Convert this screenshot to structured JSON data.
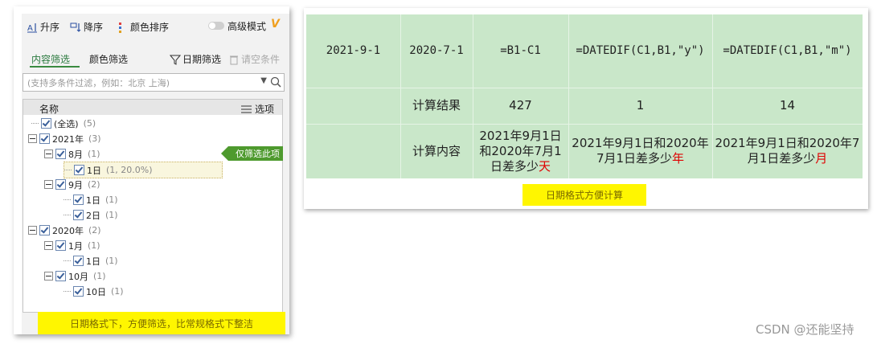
{
  "left_panel": {
    "toolbar": {
      "sort_asc": "升序",
      "sort_desc": "降序",
      "color_sort": "颜色排序",
      "advanced_mode": "高级模式"
    },
    "tabs": {
      "content": "内容筛选",
      "color": "颜色筛选"
    },
    "date_filter": "日期筛选",
    "clear": "请空条件",
    "search_placeholder": "(支持多条件过滤，例如：北京  上海)",
    "tree_header": {
      "name": "名称",
      "options": "选项"
    },
    "tree": [
      {
        "label": "(全选)",
        "count": "(5)"
      },
      {
        "label": "2021年",
        "count": "(3)"
      },
      {
        "label": "8月",
        "count": "(1)"
      },
      {
        "label": "1日",
        "count": "(1, 20.0%)"
      },
      {
        "label": "9月",
        "count": "(2)"
      },
      {
        "label": "1日",
        "count": "(1)"
      },
      {
        "label": "2日",
        "count": "(1)"
      },
      {
        "label": "2020年",
        "count": "(2)"
      },
      {
        "label": "1月",
        "count": "(1)"
      },
      {
        "label": "1日",
        "count": "(1)"
      },
      {
        "label": "10月",
        "count": "(1)"
      },
      {
        "label": "10日",
        "count": "(1)"
      }
    ],
    "only_filter": "仅筛选此项",
    "note": "日期格式下，方便筛选，比常规格式下整洁"
  },
  "sheet": {
    "row1": [
      "2021-9-1",
      "2020-7-1",
      "=B1-C1",
      "=DATEDIF(C1,B1,\"y\")",
      "=DATEDIF(C1,B1,\"m\")"
    ],
    "row2": [
      "",
      "计算结果",
      "427",
      "1",
      "14"
    ],
    "row3": {
      "label": "计算内容",
      "c": {
        "text": "2021年9月1日和2020年7月1日差多少",
        "unit": "天"
      },
      "d": {
        "text": "2021年9月1日和2020年7月1日差多少",
        "unit": "年"
      },
      "e": {
        "text": "2021年9月1日和2020年7月1日差多少",
        "unit": "月"
      }
    },
    "note": "日期格式方便计算"
  },
  "watermark": "CSDN @还能坚持",
  "colors": {
    "sheet_bg": "#c9e7c9",
    "highlight": "#fff600",
    "badge": "#4e9a2e",
    "unit_red": "#e00000"
  }
}
